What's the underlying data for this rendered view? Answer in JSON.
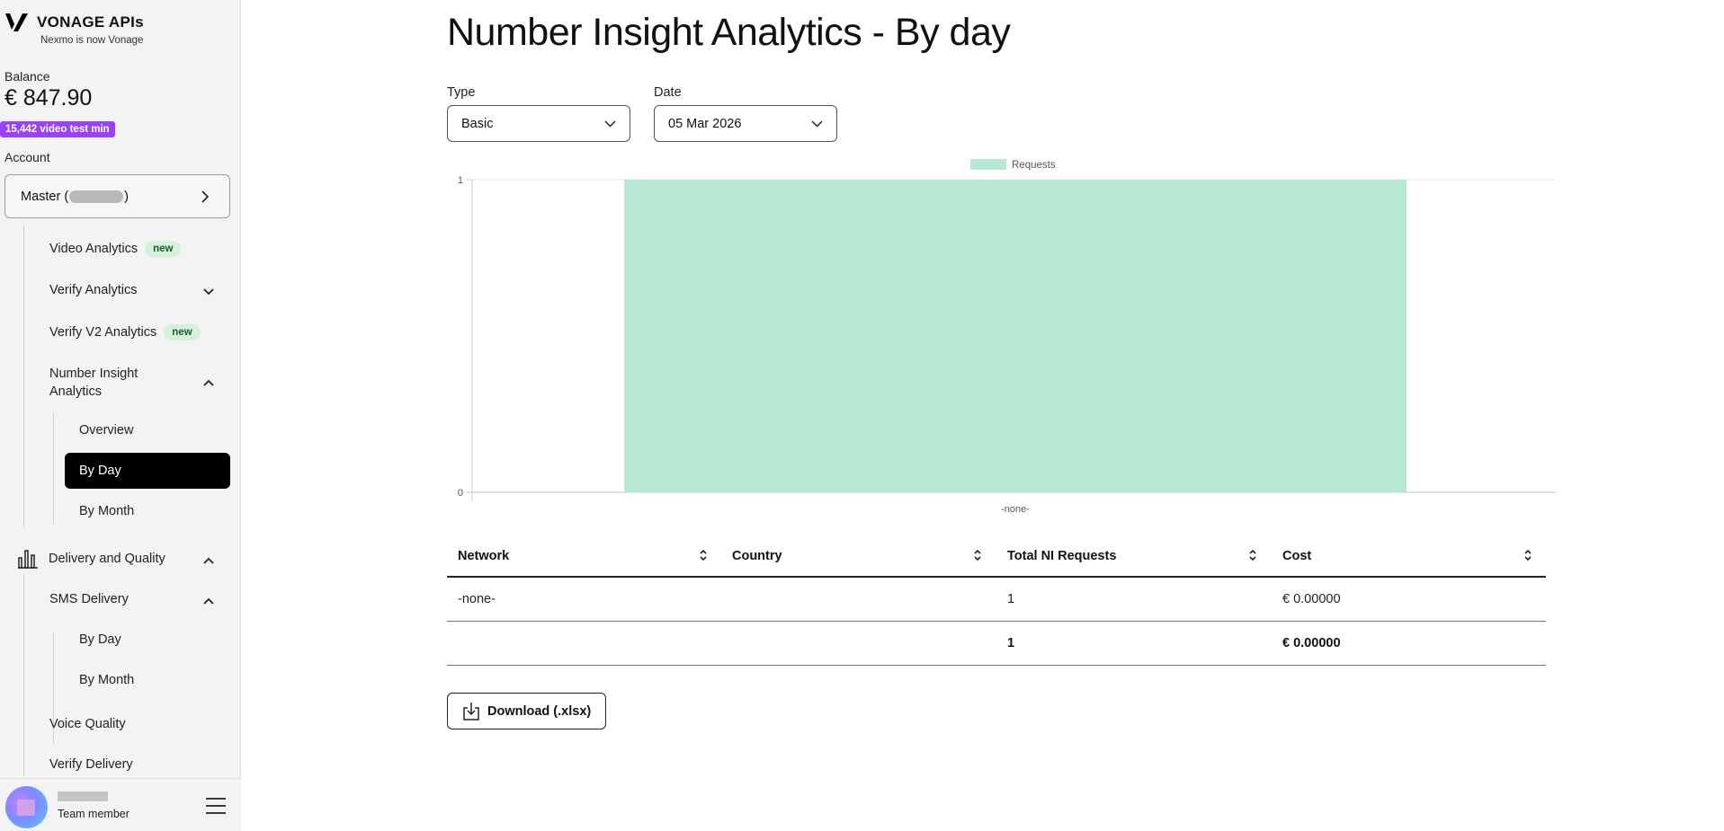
{
  "brand": {
    "name": "VONAGE APIs",
    "subtitle": "Nexmo is now Vonage",
    "logo_icon": "vonage-logo-icon"
  },
  "balance": {
    "label": "Balance",
    "value": "€ 847.90",
    "badge": "15,442 video test min",
    "badge_color": "#9941ff"
  },
  "account": {
    "label": "Account",
    "prefix": "Master (",
    "suffix": ")"
  },
  "nav": {
    "video_analytics": {
      "label": "Video Analytics",
      "tag": "new"
    },
    "verify_analytics": {
      "label": "Verify Analytics"
    },
    "verify_v2_analytics": {
      "label": "Verify V2 Analytics",
      "tag": "new"
    },
    "number_insight_analytics": {
      "label_line1": "Number Insight",
      "label_line2": "Analytics"
    },
    "ni_overview": "Overview",
    "ni_by_day": "By Day",
    "ni_by_month": "By Month",
    "delivery_quality": {
      "label": "Delivery and Quality",
      "icon": "bar-chart-icon"
    },
    "sms_delivery": {
      "label": "SMS Delivery"
    },
    "sms_by_day": "By Day",
    "sms_by_month": "By Month",
    "voice_quality": "Voice Quality",
    "verify_delivery": "Verify Delivery"
  },
  "user": {
    "role": "Team member"
  },
  "page": {
    "title": "Number Insight Analytics - By day"
  },
  "filters": {
    "type_label": "Type",
    "type_value": "Basic",
    "date_label": "Date",
    "date_value": "05 Mar 2026"
  },
  "chart_data": {
    "type": "bar",
    "categories": [
      "-none-"
    ],
    "series": [
      {
        "name": "Requests",
        "values": [
          1
        ],
        "color": "#b8e7d3"
      }
    ],
    "ylim": [
      0,
      1
    ],
    "yticks": [
      "0",
      "1"
    ],
    "legend": "top-center",
    "title": "",
    "xlabel": "",
    "ylabel": ""
  },
  "table": {
    "headers": [
      "Network",
      "Country",
      "Total NI Requests",
      "Cost"
    ],
    "rows": [
      [
        "-none-",
        "",
        "1",
        "€ 0.00000"
      ]
    ],
    "totals": [
      "",
      "",
      "1",
      "€ 0.00000"
    ]
  },
  "download": {
    "label": "Download (.xlsx)"
  }
}
